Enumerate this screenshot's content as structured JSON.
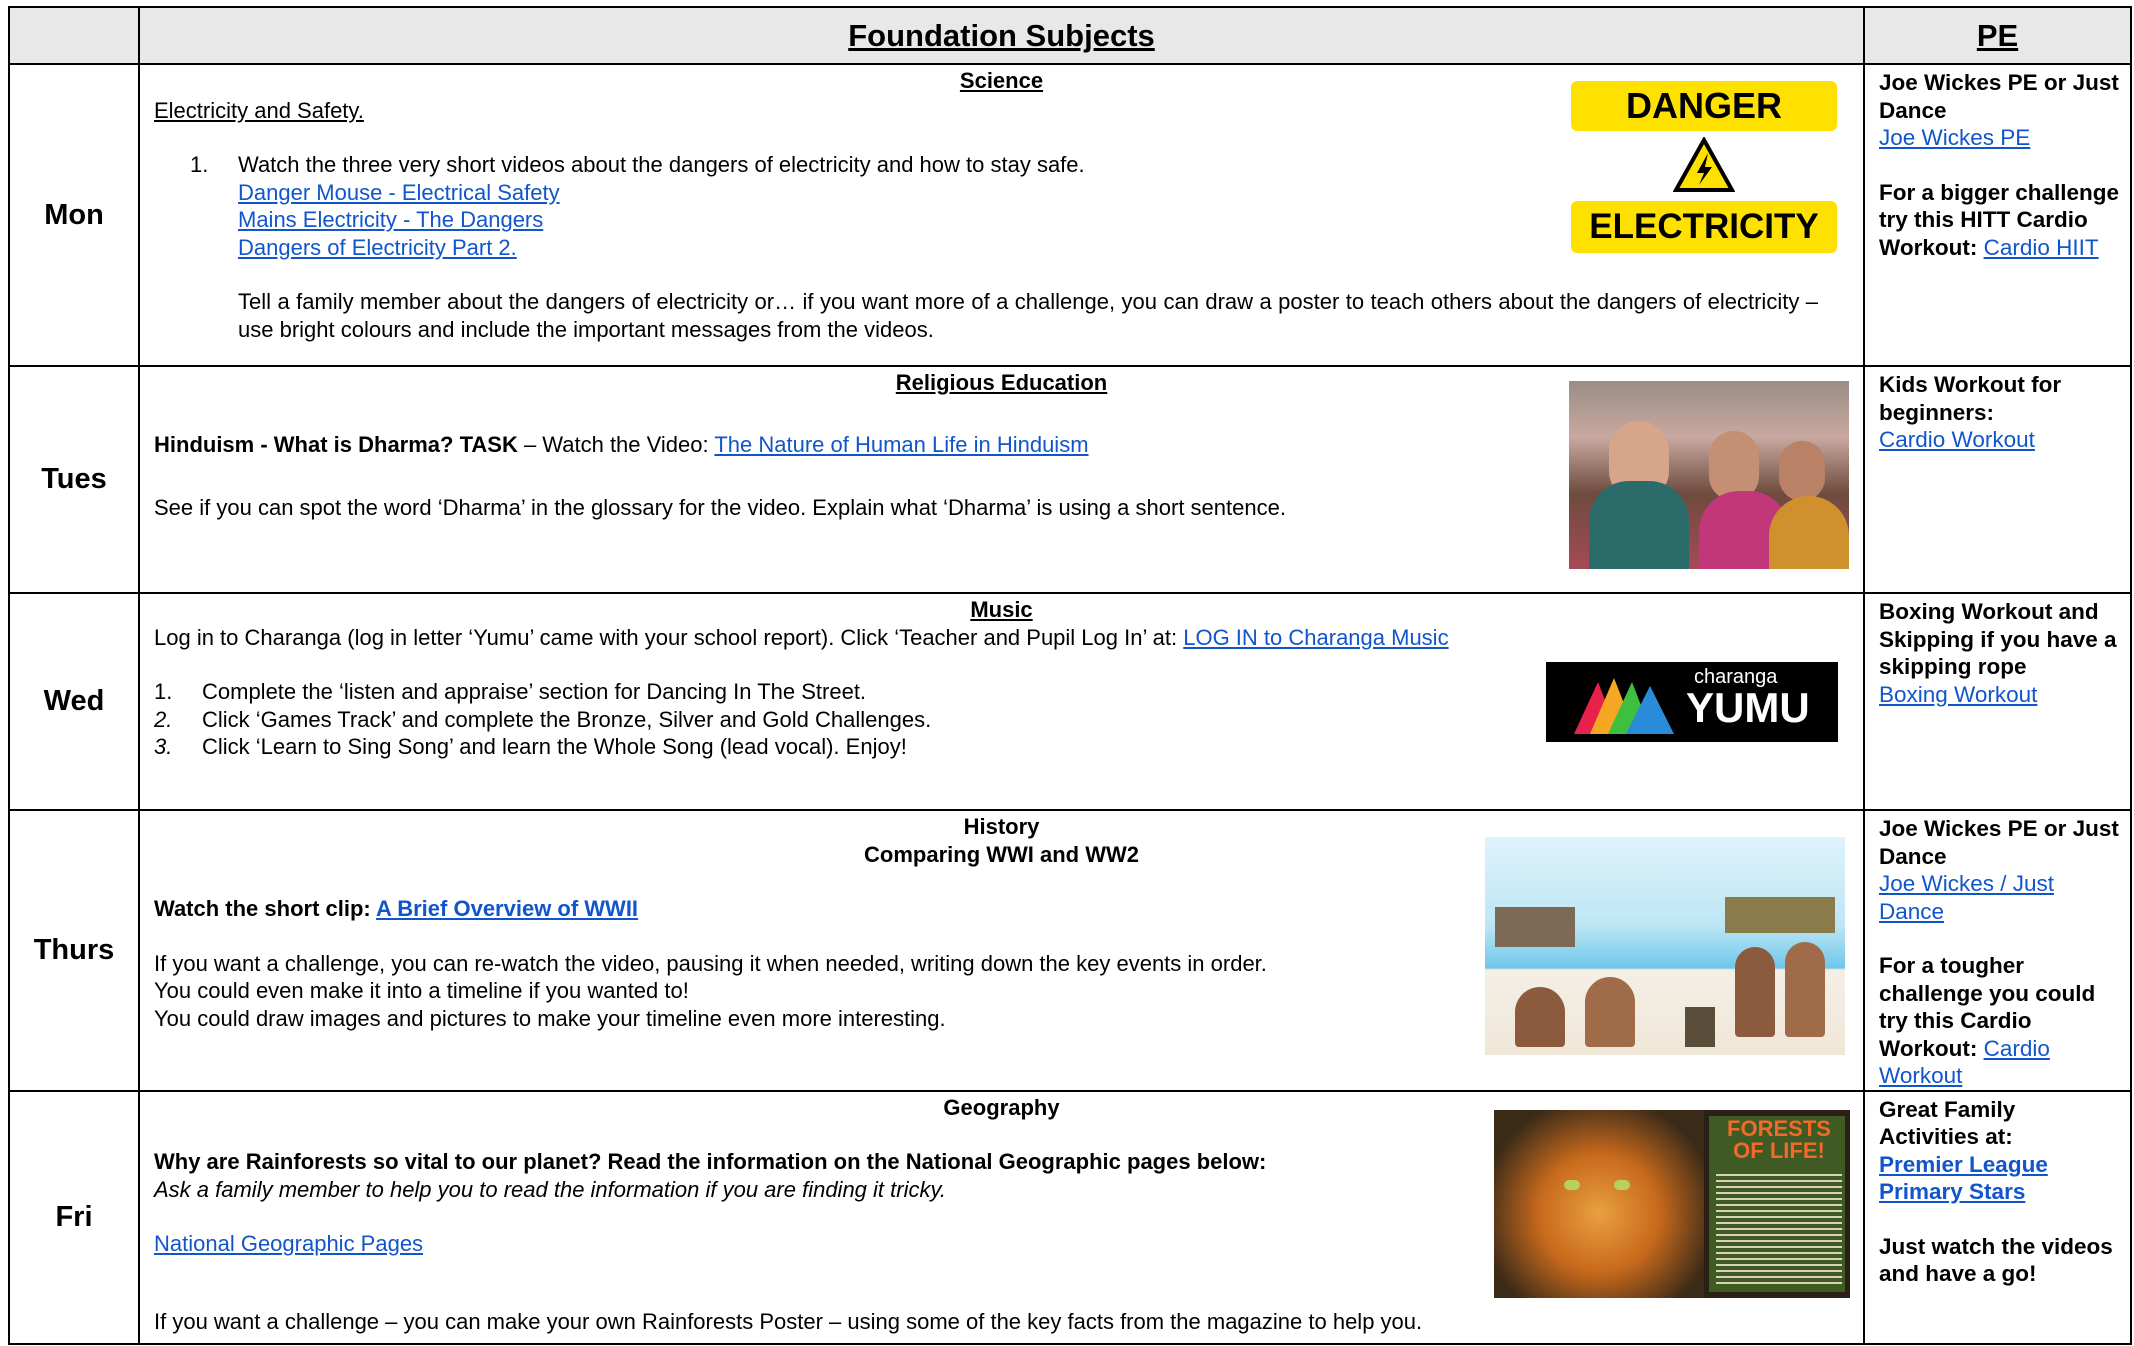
{
  "header": {
    "foundation": "Foundation Subjects",
    "pe": "PE"
  },
  "days": [
    "Mon",
    "Tues",
    "Wed",
    "Thurs",
    "Fri"
  ],
  "mon": {
    "subject": "Science",
    "topic": "Electricity and Safety.",
    "step_num": "1.",
    "step_text": "Watch the three very short videos about the dangers of electricity and how to stay safe.",
    "links": [
      "Danger Mouse - Electrical Safety",
      "Mains Electricity - The Dangers",
      "Dangers of Electricity Part 2."
    ],
    "task": "Tell a family member about the dangers of electricity or… if you want more of a challenge, you can draw a poster to teach others about the dangers of electricity – use bright colours and include the important messages from the videos.",
    "sign_top": "DANGER",
    "sign_bottom": "ELECTRICITY",
    "pe": {
      "title": "Joe Wickes PE or Just Dance",
      "link": "Joe Wickes PE",
      "challenge": "For a bigger challenge try this HITT Cardio Workout:",
      "challenge_link": "Cardio HIIT"
    }
  },
  "tue": {
    "subject": "Religious Education",
    "lead_bold": "Hinduism - What is Dharma? TASK",
    "lead_rest": " – Watch the Video: ",
    "link": "The Nature of Human Life in Hinduism",
    "text2": "See if you can spot the word ‘Dharma’ in the glossary for the video. Explain what ‘Dharma’ is using a short sentence.",
    "pe": {
      "title": "Kids Workout for beginners:",
      "link": "Cardio Workout"
    }
  },
  "wed": {
    "subject": "Music",
    "intro": "Log in to Charanga (log in letter ‘Yumu’ came with your school report). Click ‘Teacher and Pupil Log In’ at: ",
    "link": "LOG IN to Charanga Music",
    "items": [
      {
        "num": "1.",
        "text": "Complete the ‘listen and appraise’ section for Dancing In The Street."
      },
      {
        "num": "2.",
        "text": "Click ‘Games Track’ and complete the Bronze, Silver and Gold Challenges."
      },
      {
        "num": "3.",
        "text": "Click ‘Learn to Sing Song’ and learn the Whole Song (lead vocal). Enjoy!"
      }
    ],
    "logo_small": "charanga",
    "logo_big": "YUMU",
    "pe": {
      "title": "Boxing Workout and Skipping if you have a skipping rope",
      "link": "Boxing Workout"
    }
  },
  "thu": {
    "subject": "History",
    "subtitle": "Comparing WWI and WW2",
    "lead": "Watch the short clip: ",
    "link": "A Brief Overview of WWII",
    "lines": [
      "If you want a challenge, you can re-watch the video, pausing it when needed, writing down the key events in order.",
      "You could even make it into a timeline if you wanted to!",
      "You could draw images and pictures to make your timeline even more interesting."
    ],
    "pe": {
      "title": "Joe Wickes PE or Just Dance",
      "link": "Joe Wickes / Just Dance",
      "challenge": "For a tougher challenge you could try this Cardio Workout:",
      "challenge_link": "Cardio Workout"
    }
  },
  "fri": {
    "subject": "Geography",
    "question": "Why are Rainforests so vital to our planet? Read the information on the National Geographic pages below:",
    "help": "Ask a family member to help you to read the information if you are finding it tricky.",
    "link": "National Geographic Pages",
    "challenge": "If you want a challenge – you can make your own Rainforests Poster – using some of the key facts from the magazine to help you.",
    "mag_title": "FORESTS OF LIFE!",
    "pe": {
      "title": "Great Family Activities at:",
      "link": "Premier League Primary Stars",
      "tail": "Just watch the videos and have a go!"
    }
  }
}
